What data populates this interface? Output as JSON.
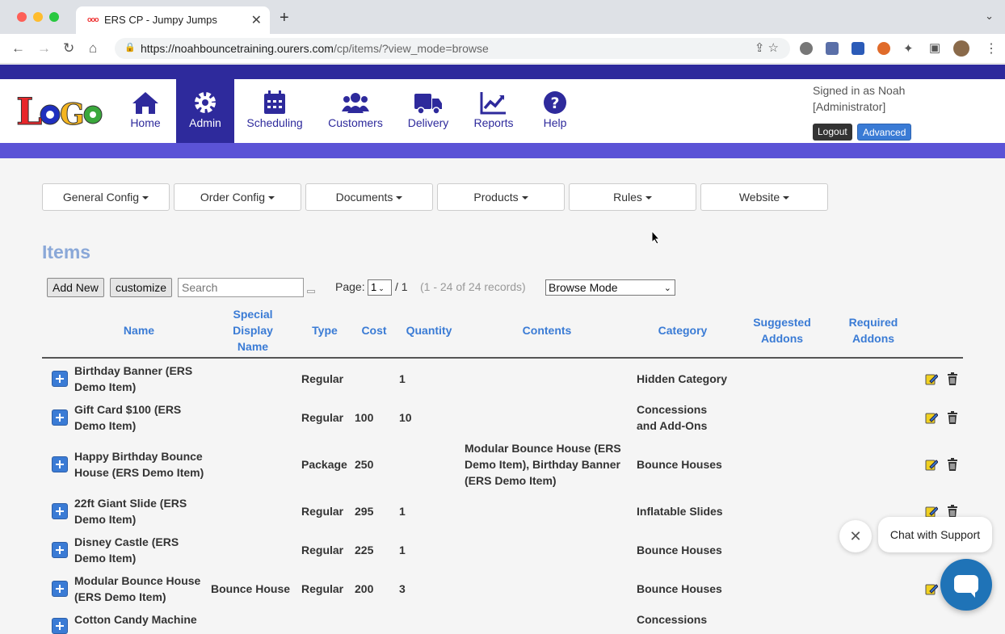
{
  "browser": {
    "tab_title": "ERS CP - Jumpy Jumps",
    "tab_favicon": "ooo",
    "url_host": "https://noahbouncetraining.ourers.com",
    "url_path": "/cp/items/?view_mode=browse"
  },
  "header": {
    "logo_text": "LoGo",
    "nav": [
      {
        "label": "Home",
        "icon": "home-icon"
      },
      {
        "label": "Admin",
        "icon": "gear-icon",
        "active": true
      },
      {
        "label": "Scheduling",
        "icon": "calendar-icon"
      },
      {
        "label": "Customers",
        "icon": "users-icon"
      },
      {
        "label": "Delivery",
        "icon": "truck-icon"
      },
      {
        "label": "Reports",
        "icon": "chart-icon"
      },
      {
        "label": "Help",
        "icon": "help-icon"
      }
    ],
    "signed_in_line1": "Signed in as Noah",
    "signed_in_line2": "[Administrator]",
    "logout_label": "Logout",
    "advanced_label": "Advanced",
    "brand_color": "#2e2a9c",
    "accent_color": "#3a7bd5"
  },
  "menus": [
    "General Config",
    "Order Config",
    "Documents",
    "Products",
    "Rules",
    "Website"
  ],
  "page_title": "Items",
  "controls": {
    "add_new_label": "Add New",
    "customize_label": "customize",
    "search_placeholder": "Search",
    "page_label": "Page:",
    "page_value": "1",
    "page_total": "1",
    "records_text": "(1 - 24 of 24 records)",
    "mode_value": "Browse Mode"
  },
  "table": {
    "columns": [
      "Name",
      "Special Display Name",
      "Type",
      "Cost",
      "Quantity",
      "Contents",
      "Category",
      "Suggested Addons",
      "Required Addons"
    ],
    "rows": [
      {
        "name": "Birthday Banner (ERS Demo Item)",
        "special": "",
        "type": "Regular",
        "cost": "",
        "qty": "1",
        "contents": "",
        "category": "Hidden Category"
      },
      {
        "name": "Gift Card $100 (ERS Demo Item)",
        "special": "",
        "type": "Regular",
        "cost": "100",
        "qty": "10",
        "contents": "",
        "category": "Concessions and Add-Ons"
      },
      {
        "name": "Happy Birthday Bounce House (ERS Demo Item)",
        "special": "",
        "type": "Package",
        "cost": "250",
        "qty": "",
        "contents": "Modular Bounce House (ERS Demo Item), Birthday Banner (ERS Demo Item)",
        "category": "Bounce Houses"
      },
      {
        "name": "22ft Giant Slide (ERS Demo Item)",
        "special": "",
        "type": "Regular",
        "cost": "295",
        "qty": "1",
        "contents": "",
        "category": "Inflatable Slides"
      },
      {
        "name": "Disney Castle (ERS Demo Item)",
        "special": "",
        "type": "Regular",
        "cost": "225",
        "qty": "1",
        "contents": "",
        "category": "Bounce Houses"
      },
      {
        "name": "Modular Bounce House (ERS Demo Item)",
        "special": "Bounce House",
        "type": "Regular",
        "cost": "200",
        "qty": "3",
        "contents": "",
        "category": "Bounce Houses"
      },
      {
        "name": "Cotton Candy Machine",
        "special": "",
        "type": "",
        "cost": "",
        "qty": "",
        "contents": "",
        "category": "Concessions"
      }
    ]
  },
  "chat": {
    "label": "Chat with Support",
    "color": "#1f73b7"
  }
}
